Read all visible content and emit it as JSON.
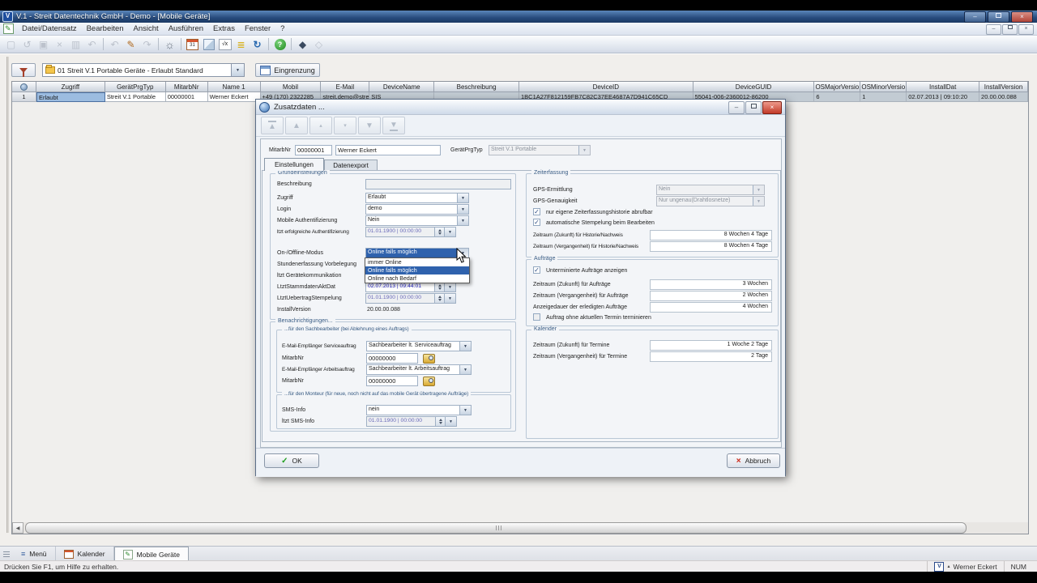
{
  "colors": {
    "selection_blue": "#2f62ad",
    "date_text_blue": "#1c1cc0",
    "ok_green": "#1f9e1f",
    "cancel_red": "#cc2a1a"
  },
  "icons": {
    "arrow_down": "▼",
    "arrow_left": "◀",
    "arrow_up": "▲",
    "small_up": "▴",
    "small_down": "▾",
    "check": "✓",
    "close": "×",
    "minimize": "–",
    "help": "?",
    "menu_lines": "≡",
    "pencil": "✎",
    "gear": "☼",
    "history": "↺",
    "undo": "↶",
    "redo": "↷",
    "refresh": "↻",
    "save": "▣",
    "new": "▢",
    "copy": "▥",
    "formula": "√x",
    "layers": "≣",
    "diamond": "◆",
    "diamond_open": "◇",
    "cal_num": "31",
    "logo_v": "V"
  },
  "titlebar": {
    "title": "V.1 - Streit Datentechnik GmbH - Demo - [Mobile Geräte]"
  },
  "menubar": {
    "items": [
      "Datei/Datensatz",
      "Bearbeiten",
      "Ansicht",
      "Ausführen",
      "Extras",
      "Fenster",
      "?"
    ]
  },
  "filterbar": {
    "profile_value": "01 Streit V.1 Portable Geräte - Erlaubt Standard",
    "eingrenzung_label": "Eingrenzung"
  },
  "table": {
    "headers": [
      "Zugriff",
      "GerätPrgTyp",
      "MitarbNr",
      "Name 1",
      "Mobil",
      "E-Mail",
      "DeviceName",
      "Beschreibung",
      "DeviceID",
      "DeviceGUID",
      "OSMajorVersio",
      "OSMinorVersio",
      "InstallDat",
      "InstallVersion"
    ],
    "row": {
      "num": "1",
      "zugriff": "Erlaubt",
      "geraetprgtyp": "Streit V.1 Portable",
      "mitarbnr": "00000001",
      "name1": "Werner Eckert",
      "mobil": "+49 (170) 2322285",
      "email": "streit.demo@streit...",
      "devicename": "SIS",
      "beschreibung": "",
      "deviceid": "1BC1A27F812159FB7C82C37EE4687A7D941C65CD",
      "deviceguid": "55041-006-2360012-86200",
      "osmajor": "6",
      "osminor": "1",
      "installdat": "02.07.2013 | 09:10:20",
      "installversion": "20.00.00.088"
    }
  },
  "dialog": {
    "title": "Zusatzdaten ...",
    "header": {
      "mitarbnr_label": "MitarbNr",
      "mitarbnr": "00000001",
      "name": "Werner Eckert",
      "prgtyp_label": "GerätPrgTyp",
      "prgtyp": "Streit V.1 Portable"
    },
    "tabs": {
      "einstellungen": "Einstellungen",
      "datenexport": "Datenexport"
    },
    "grund": {
      "title": "Grundeinstellungen",
      "beschreibung_label": "Beschreibung",
      "beschreibung": "",
      "zugriff_label": "Zugriff",
      "zugriff": "Erlaubt",
      "login_label": "Login",
      "login": "demo",
      "mobile_auth_label": "Mobile Authentifizierung",
      "mobile_auth": "Nein",
      "ltzt_auth_label": "ltzt erfolgreiche Authentifizierung",
      "ltzt_auth": "01.01.1900 | 00:00:00",
      "onoffline_label": "On-/Offline-Modus",
      "onoffline": "Online falls möglich",
      "options": [
        "immer Online",
        "Online falls möglich",
        "Online nach Bedarf"
      ],
      "stunden_label": "Stundenerfassung Vorbelegung",
      "geraetkomm_label": "ltzt Gerätekommunikation",
      "stammdaten_label": "LtztStammdatenAktDat",
      "stammdaten": "02.07.2013 | 09:44:01",
      "uebertrag_label": "LtztUebertragStempelung",
      "uebertrag": "01.01.1900 | 00:00:00",
      "installversion_label": "InstallVersion",
      "installversion": "20.00.00.088"
    },
    "benach": {
      "title": "Benachrichtigungen...",
      "sach_title": "...für den Sachbearbeiter (bei Ablehnung eines Auftrags)",
      "email_service_label": "E-Mail-Empfänger Serviceauftrag",
      "email_service": "Sachbearbeiter lt. Serviceauftrag",
      "mitarbnr1_label": "MitarbNr",
      "mitarbnr1": "00000000",
      "email_arbeit_label": "E-Mail-Empfänger Arbeitsauftrag",
      "email_arbeit": "Sachbearbeiter lt. Arbeitsauftrag",
      "mitarbnr2_label": "MitarbNr",
      "mitarbnr2": "00000000",
      "monteur_title": "...für den Monteur (für neue, noch nicht auf das mobile Gerät übertragene Aufträge)",
      "sms_label": "SMS-Info",
      "sms": "nein",
      "ltzt_sms_label": "ltzt SMS-Info",
      "ltzt_sms": "01.01.1900 | 00:00:00"
    },
    "zeit": {
      "title": "Zeiterfassung",
      "gps_label": "GPS-Ermittlung",
      "gps": "Nein",
      "gps_gen_label": "GPS-Genauigkeit",
      "gps_gen": "Nur ungenau(Drahtlosnetze)",
      "cb1": "nur eigene Zeiterfassungshistorie abrufbar",
      "cb2": "automatische Stempelung beim Bearbeiten",
      "zuk_label": "Zeitraum (Zukunft) für Historie/Nachweis",
      "zuk": "8 Wochen 4 Tage",
      "verg_label": "Zeitraum (Vergangenheit) für Historie/Nachweis",
      "verg": "8 Wochen 4 Tage"
    },
    "auftraege": {
      "title": "Aufträge",
      "cb1": "Unterminierte Aufträge anzeigen",
      "zuk_label": "Zeitraum (Zukunft) für Aufträge",
      "zuk": "3 Wochen",
      "verg_label": "Zeitraum (Vergangenheit) für Aufträge",
      "verg": "2 Wochen",
      "anzeige_label": "Anzeigedauer der erledigten Aufträge",
      "anzeige": "4 Wochen",
      "cb2": "Auftrag ohne aktuellen Termin terminieren"
    },
    "kalender": {
      "title": "Kalender",
      "zuk_label": "Zeitraum (Zukunft) für Termine",
      "zuk": "1 Woche 2 Tage",
      "verg_label": "Zeitraum (Vergangenheit) für Termine",
      "verg": "2 Tage"
    },
    "footer": {
      "ok": "OK",
      "abbruch": "Abbruch"
    }
  },
  "bottombar": {
    "tabs": [
      "Menü",
      "Kalender",
      "Mobile Geräte"
    ]
  },
  "statusbar": {
    "hint": "Drücken Sie F1, um Hilfe zu erhalten.",
    "user": "Werner Eckert",
    "num": "NUM"
  }
}
